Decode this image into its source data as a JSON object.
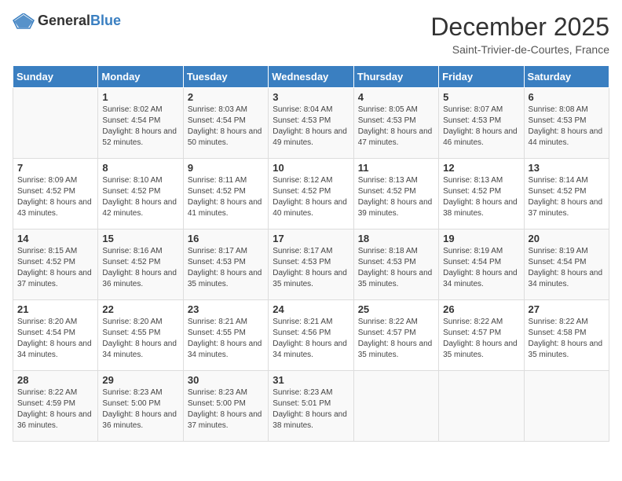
{
  "logo": {
    "text_general": "General",
    "text_blue": "Blue"
  },
  "header": {
    "month": "December 2025",
    "location": "Saint-Trivier-de-Courtes, France"
  },
  "weekdays": [
    "Sunday",
    "Monday",
    "Tuesday",
    "Wednesday",
    "Thursday",
    "Friday",
    "Saturday"
  ],
  "weeks": [
    [
      {
        "day": "",
        "sunrise": "",
        "sunset": "",
        "daylight": ""
      },
      {
        "day": "1",
        "sunrise": "Sunrise: 8:02 AM",
        "sunset": "Sunset: 4:54 PM",
        "daylight": "Daylight: 8 hours and 52 minutes."
      },
      {
        "day": "2",
        "sunrise": "Sunrise: 8:03 AM",
        "sunset": "Sunset: 4:54 PM",
        "daylight": "Daylight: 8 hours and 50 minutes."
      },
      {
        "day": "3",
        "sunrise": "Sunrise: 8:04 AM",
        "sunset": "Sunset: 4:53 PM",
        "daylight": "Daylight: 8 hours and 49 minutes."
      },
      {
        "day": "4",
        "sunrise": "Sunrise: 8:05 AM",
        "sunset": "Sunset: 4:53 PM",
        "daylight": "Daylight: 8 hours and 47 minutes."
      },
      {
        "day": "5",
        "sunrise": "Sunrise: 8:07 AM",
        "sunset": "Sunset: 4:53 PM",
        "daylight": "Daylight: 8 hours and 46 minutes."
      },
      {
        "day": "6",
        "sunrise": "Sunrise: 8:08 AM",
        "sunset": "Sunset: 4:53 PM",
        "daylight": "Daylight: 8 hours and 44 minutes."
      }
    ],
    [
      {
        "day": "7",
        "sunrise": "Sunrise: 8:09 AM",
        "sunset": "Sunset: 4:52 PM",
        "daylight": "Daylight: 8 hours and 43 minutes."
      },
      {
        "day": "8",
        "sunrise": "Sunrise: 8:10 AM",
        "sunset": "Sunset: 4:52 PM",
        "daylight": "Daylight: 8 hours and 42 minutes."
      },
      {
        "day": "9",
        "sunrise": "Sunrise: 8:11 AM",
        "sunset": "Sunset: 4:52 PM",
        "daylight": "Daylight: 8 hours and 41 minutes."
      },
      {
        "day": "10",
        "sunrise": "Sunrise: 8:12 AM",
        "sunset": "Sunset: 4:52 PM",
        "daylight": "Daylight: 8 hours and 40 minutes."
      },
      {
        "day": "11",
        "sunrise": "Sunrise: 8:13 AM",
        "sunset": "Sunset: 4:52 PM",
        "daylight": "Daylight: 8 hours and 39 minutes."
      },
      {
        "day": "12",
        "sunrise": "Sunrise: 8:13 AM",
        "sunset": "Sunset: 4:52 PM",
        "daylight": "Daylight: 8 hours and 38 minutes."
      },
      {
        "day": "13",
        "sunrise": "Sunrise: 8:14 AM",
        "sunset": "Sunset: 4:52 PM",
        "daylight": "Daylight: 8 hours and 37 minutes."
      }
    ],
    [
      {
        "day": "14",
        "sunrise": "Sunrise: 8:15 AM",
        "sunset": "Sunset: 4:52 PM",
        "daylight": "Daylight: 8 hours and 37 minutes."
      },
      {
        "day": "15",
        "sunrise": "Sunrise: 8:16 AM",
        "sunset": "Sunset: 4:52 PM",
        "daylight": "Daylight: 8 hours and 36 minutes."
      },
      {
        "day": "16",
        "sunrise": "Sunrise: 8:17 AM",
        "sunset": "Sunset: 4:53 PM",
        "daylight": "Daylight: 8 hours and 35 minutes."
      },
      {
        "day": "17",
        "sunrise": "Sunrise: 8:17 AM",
        "sunset": "Sunset: 4:53 PM",
        "daylight": "Daylight: 8 hours and 35 minutes."
      },
      {
        "day": "18",
        "sunrise": "Sunrise: 8:18 AM",
        "sunset": "Sunset: 4:53 PM",
        "daylight": "Daylight: 8 hours and 35 minutes."
      },
      {
        "day": "19",
        "sunrise": "Sunrise: 8:19 AM",
        "sunset": "Sunset: 4:54 PM",
        "daylight": "Daylight: 8 hours and 34 minutes."
      },
      {
        "day": "20",
        "sunrise": "Sunrise: 8:19 AM",
        "sunset": "Sunset: 4:54 PM",
        "daylight": "Daylight: 8 hours and 34 minutes."
      }
    ],
    [
      {
        "day": "21",
        "sunrise": "Sunrise: 8:20 AM",
        "sunset": "Sunset: 4:54 PM",
        "daylight": "Daylight: 8 hours and 34 minutes."
      },
      {
        "day": "22",
        "sunrise": "Sunrise: 8:20 AM",
        "sunset": "Sunset: 4:55 PM",
        "daylight": "Daylight: 8 hours and 34 minutes."
      },
      {
        "day": "23",
        "sunrise": "Sunrise: 8:21 AM",
        "sunset": "Sunset: 4:55 PM",
        "daylight": "Daylight: 8 hours and 34 minutes."
      },
      {
        "day": "24",
        "sunrise": "Sunrise: 8:21 AM",
        "sunset": "Sunset: 4:56 PM",
        "daylight": "Daylight: 8 hours and 34 minutes."
      },
      {
        "day": "25",
        "sunrise": "Sunrise: 8:22 AM",
        "sunset": "Sunset: 4:57 PM",
        "daylight": "Daylight: 8 hours and 35 minutes."
      },
      {
        "day": "26",
        "sunrise": "Sunrise: 8:22 AM",
        "sunset": "Sunset: 4:57 PM",
        "daylight": "Daylight: 8 hours and 35 minutes."
      },
      {
        "day": "27",
        "sunrise": "Sunrise: 8:22 AM",
        "sunset": "Sunset: 4:58 PM",
        "daylight": "Daylight: 8 hours and 35 minutes."
      }
    ],
    [
      {
        "day": "28",
        "sunrise": "Sunrise: 8:22 AM",
        "sunset": "Sunset: 4:59 PM",
        "daylight": "Daylight: 8 hours and 36 minutes."
      },
      {
        "day": "29",
        "sunrise": "Sunrise: 8:23 AM",
        "sunset": "Sunset: 5:00 PM",
        "daylight": "Daylight: 8 hours and 36 minutes."
      },
      {
        "day": "30",
        "sunrise": "Sunrise: 8:23 AM",
        "sunset": "Sunset: 5:00 PM",
        "daylight": "Daylight: 8 hours and 37 minutes."
      },
      {
        "day": "31",
        "sunrise": "Sunrise: 8:23 AM",
        "sunset": "Sunset: 5:01 PM",
        "daylight": "Daylight: 8 hours and 38 minutes."
      },
      {
        "day": "",
        "sunrise": "",
        "sunset": "",
        "daylight": ""
      },
      {
        "day": "",
        "sunrise": "",
        "sunset": "",
        "daylight": ""
      },
      {
        "day": "",
        "sunrise": "",
        "sunset": "",
        "daylight": ""
      }
    ]
  ]
}
